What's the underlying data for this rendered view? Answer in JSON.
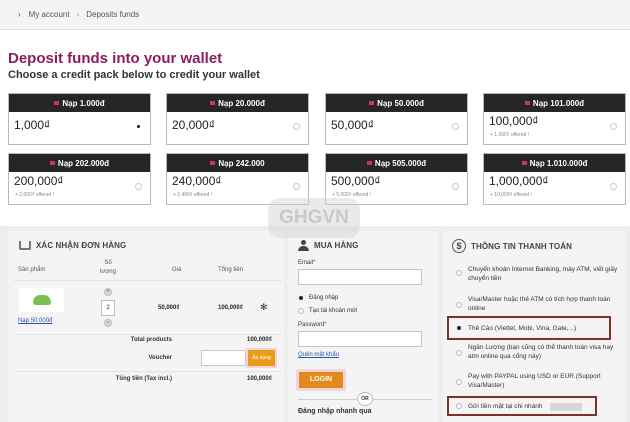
{
  "breadcrumb": [
    "My account",
    "Deposits funds"
  ],
  "title": "Deposit funds into your wallet",
  "subtitle": "Choose a credit pack below to credit your wallet",
  "packs": [
    {
      "label": "Nạp 1.000đ",
      "amount": "1,000₫",
      "offer": "",
      "selected": true
    },
    {
      "label": "Nạp 20.000đ",
      "amount": "20,000₫",
      "offer": "",
      "selected": false
    },
    {
      "label": "Nạp 50.000đ",
      "amount": "50,000₫",
      "offer": "",
      "selected": false
    },
    {
      "label": "Nạp 101.000đ",
      "amount": "100,000₫",
      "offer": "+ 1,000₫ offered !",
      "selected": false
    },
    {
      "label": "Nạp 202.000đ",
      "amount": "200,000₫",
      "offer": "+ 2,000₫ offered !",
      "selected": false
    },
    {
      "label": "Nạp 242.000",
      "amount": "240,000₫",
      "offer": "+ 2,400₫ offered !",
      "selected": false
    },
    {
      "label": "Nạp 505.000đ",
      "amount": "500,000₫",
      "offer": "+ 5,000₫ offered !",
      "selected": false
    },
    {
      "label": "Nạp 1.010.000đ",
      "amount": "1,000,000₫",
      "offer": "+ 10,000₫ offered !",
      "selected": false
    }
  ],
  "order": {
    "heading": "XÁC NHẬN ĐƠN HÀNG",
    "col_product": "Sản phẩm",
    "col_qty": "Số lượng",
    "col_price": "Giá",
    "col_total": "Tổng tiền",
    "product_name": "Nạp 50.000đ",
    "qty": "2",
    "price": "50,000₫",
    "total": "100,000₫",
    "total_products_label": "Total products",
    "total_products_value": "100,000₫",
    "voucher_label": "Voucher",
    "apply_label": "Áp dụng",
    "grand_total_label": "Tổng tiền (Tax incl.)",
    "grand_total_value": "100,000₫"
  },
  "account": {
    "heading": "MUA HÀNG",
    "email_label": "Email",
    "option_login": "Đăng nhập",
    "option_new": "Tạo tài khoản mới",
    "password_label": "Password",
    "forgot": "Quên mật khẩu",
    "login_button": "LOGIN",
    "or": "OR",
    "quick_login": "Đăng nhập nhanh qua"
  },
  "payment": {
    "heading": "THÔNG TIN THANH TOÁN",
    "options": [
      "Chuyển khoản Internet Banking, máy ATM, viết giấy chuyển tiền",
      "Visa/Master hoặc thẻ ATM có tích hợp thanh toán online",
      "Thẻ Cào (Viettel, Mobi, Vina, Gate,...)",
      "Ngân Lượng (bạn cũng có thể thanh toán visa hay atm online qua cổng này)",
      "Pay with PAYPAL using USD or EUR (Support Visa/Master)",
      "Gửi tiền mặt tại chi nhánh"
    ]
  },
  "watermark": "GHGVN"
}
